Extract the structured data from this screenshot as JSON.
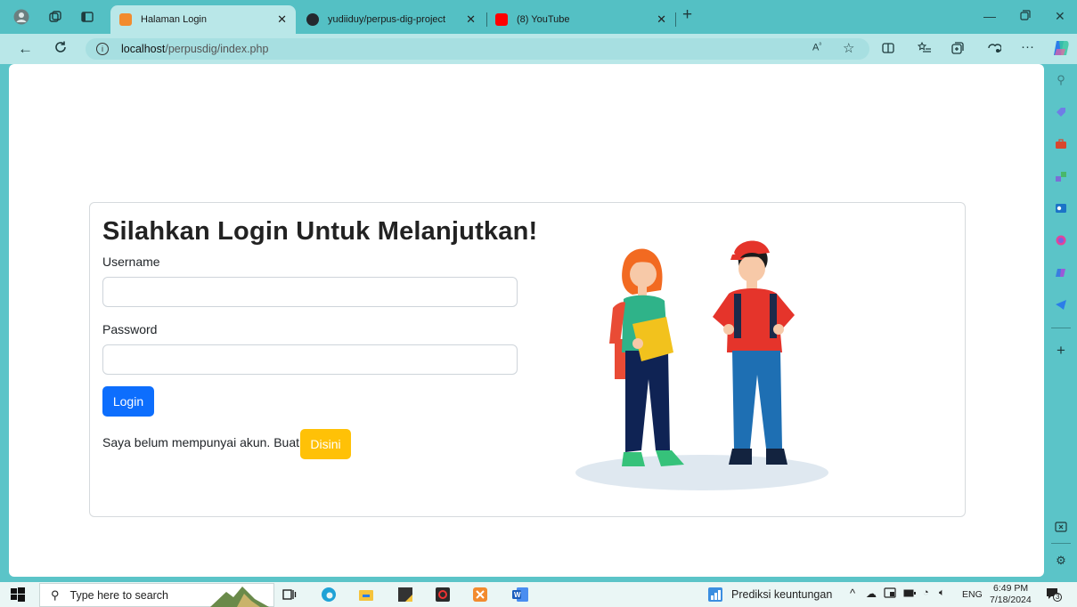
{
  "browser": {
    "tabs": [
      {
        "title": "Halaman Login",
        "active": true,
        "favicon_color": "#f28b2e"
      },
      {
        "title": "yudiiduy/perpus-dig-project",
        "active": false,
        "favicon_color": "#24292f"
      },
      {
        "title": "(8) YouTube",
        "active": false,
        "favicon_color": "#ff0000"
      }
    ],
    "url_host": "localhost",
    "url_path": "/perpusdig/index.php"
  },
  "page": {
    "title": "Silahkan Login Untuk Melanjutkan!",
    "username_label": "Username",
    "username_value": "",
    "password_label": "Password",
    "password_value": "",
    "login_button": "Login",
    "signup_prompt": "Saya belum mempunyai akun. Buat",
    "signup_button": "Disini"
  },
  "taskbar": {
    "search_placeholder": "Type here to search",
    "weather_app": "Prediksi keuntungan",
    "language": "ENG",
    "time": "6:49 PM",
    "date": "7/18/2024",
    "notification_count": "3"
  },
  "colors": {
    "primary": "#0d6efd",
    "warning": "#ffc107",
    "browser_accent": "#54c0c4"
  }
}
